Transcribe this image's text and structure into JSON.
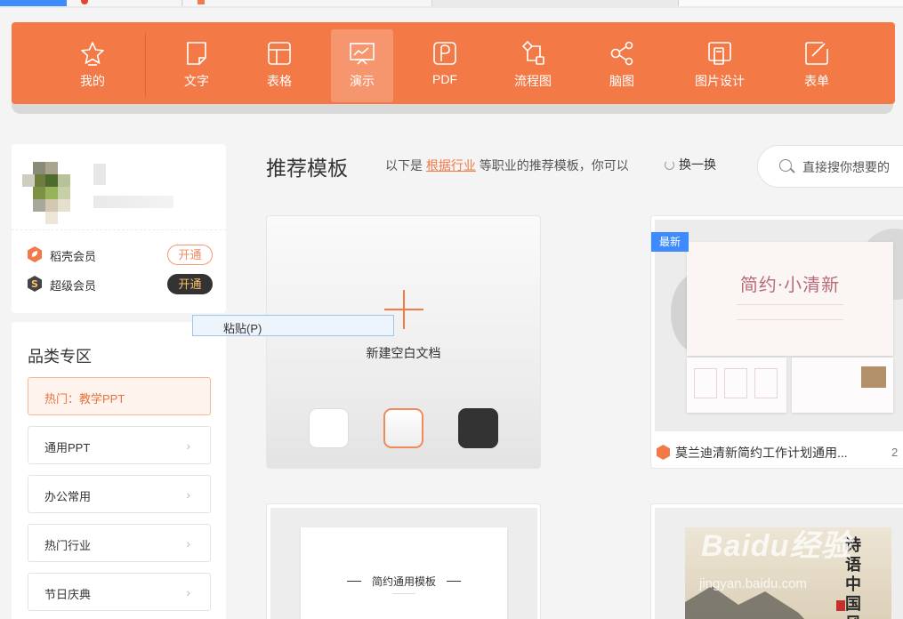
{
  "toolbar": {
    "items": [
      {
        "label": "我的",
        "icon": "star-icon"
      },
      {
        "label": "文字",
        "icon": "document-icon"
      },
      {
        "label": "表格",
        "icon": "table-icon"
      },
      {
        "label": "演示",
        "icon": "presentation-icon",
        "active": true
      },
      {
        "label": "PDF",
        "icon": "pdf-icon"
      },
      {
        "label": "流程图",
        "icon": "flowchart-icon"
      },
      {
        "label": "脑图",
        "icon": "mindmap-icon"
      },
      {
        "label": "图片设计",
        "icon": "image-design-icon"
      },
      {
        "label": "表单",
        "icon": "form-icon"
      }
    ],
    "accent": "#f37946"
  },
  "user": {
    "memberships": [
      {
        "name": "稻壳会员",
        "button": "开通"
      },
      {
        "name": "超级会员",
        "button": "开通"
      }
    ]
  },
  "categories": {
    "title": "品类专区",
    "items": [
      "热门：教学PPT",
      "通用PPT",
      "办公常用",
      "热门行业",
      "节日庆典"
    ]
  },
  "context_menu": {
    "paste_label": "粘贴(P)"
  },
  "main": {
    "title": "推荐模板",
    "subtitle_prefix": "以下是",
    "subtitle_link": "根据行业",
    "subtitle_suffix": "等职业的推荐模板，你可以",
    "refresh_label": "换一换",
    "search_placeholder": "直接搜你想要的",
    "blank": {
      "label": "新建空白文档"
    },
    "templates": [
      {
        "badge": "最新",
        "slide_title": "简约·小清新",
        "name": "莫兰迪清新简约工作计划通用...",
        "trailing": "2"
      },
      {
        "slide_title": "简约通用模板"
      },
      {
        "slide_title": "诗语中国风"
      }
    ]
  },
  "watermark": {
    "logo": "Baidu经验",
    "url": "jingyan.baidu.com"
  }
}
